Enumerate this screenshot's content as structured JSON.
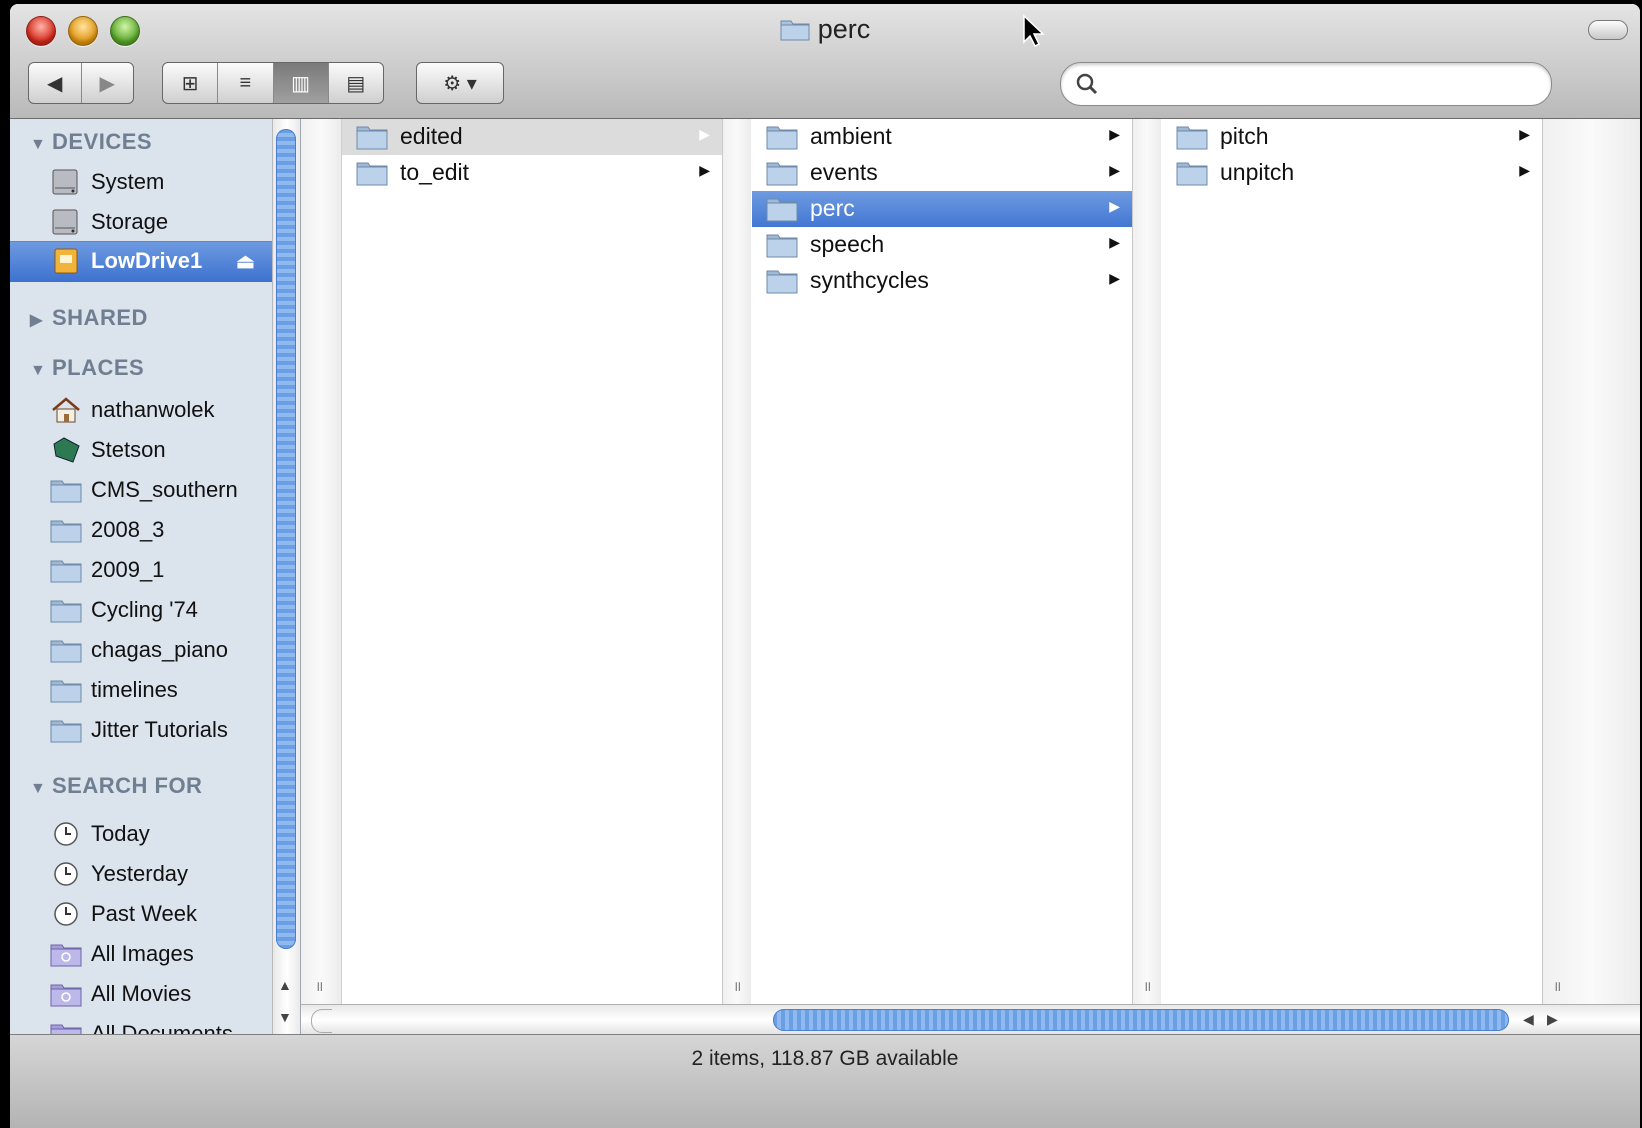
{
  "window": {
    "title": "perc"
  },
  "toolbar": {
    "back": "◀",
    "forward": "▶",
    "view_icon": "⊞",
    "view_list": "≡",
    "view_column": "▥",
    "view_coverflow": "▤",
    "action": "⚙ ▾",
    "search_placeholder": ""
  },
  "sidebar": {
    "sections": {
      "devices": "DEVICES",
      "shared": "SHARED",
      "places": "PLACES",
      "search_for": "SEARCH FOR"
    },
    "devices": [
      {
        "label": "System",
        "icon": "hard-drive-icon"
      },
      {
        "label": "Storage",
        "icon": "hard-drive-icon"
      },
      {
        "label": "LowDrive1",
        "icon": "external-drive-icon",
        "selected": true
      }
    ],
    "places": [
      {
        "label": "nathanwolek",
        "icon": "home-icon"
      },
      {
        "label": "Stetson",
        "icon": "disk-icon"
      },
      {
        "label": "CMS_southern",
        "icon": "folder-icon"
      },
      {
        "label": "2008_3",
        "icon": "folder-icon"
      },
      {
        "label": "2009_1",
        "icon": "folder-icon"
      },
      {
        "label": "Cycling '74",
        "icon": "folder-icon"
      },
      {
        "label": "chagas_piano",
        "icon": "folder-icon"
      },
      {
        "label": "timelines",
        "icon": "folder-icon"
      },
      {
        "label": "Jitter Tutorials",
        "icon": "folder-icon"
      }
    ],
    "search_for": [
      {
        "label": "Today",
        "icon": "clock-icon"
      },
      {
        "label": "Yesterday",
        "icon": "clock-icon"
      },
      {
        "label": "Past Week",
        "icon": "clock-icon"
      },
      {
        "label": "All Images",
        "icon": "smart-folder-icon"
      },
      {
        "label": "All Movies",
        "icon": "smart-folder-icon"
      },
      {
        "label": "All Documents",
        "icon": "smart-folder-icon"
      }
    ]
  },
  "columns": [
    {
      "items": [
        {
          "label": "edited",
          "state": "dim"
        },
        {
          "label": "to_edit",
          "state": ""
        }
      ]
    },
    {
      "items": [
        {
          "label": "ambient",
          "state": ""
        },
        {
          "label": "events",
          "state": ""
        },
        {
          "label": "perc",
          "state": "selected"
        },
        {
          "label": "speech",
          "state": ""
        },
        {
          "label": "synthcycles",
          "state": ""
        }
      ]
    },
    {
      "items": [
        {
          "label": "pitch",
          "state": ""
        },
        {
          "label": "unpitch",
          "state": ""
        }
      ]
    }
  ],
  "status": "2 items, 118.87 GB available",
  "colors": {
    "selection": "#4277d3",
    "sidebar_bg": "#dbe3ec"
  }
}
